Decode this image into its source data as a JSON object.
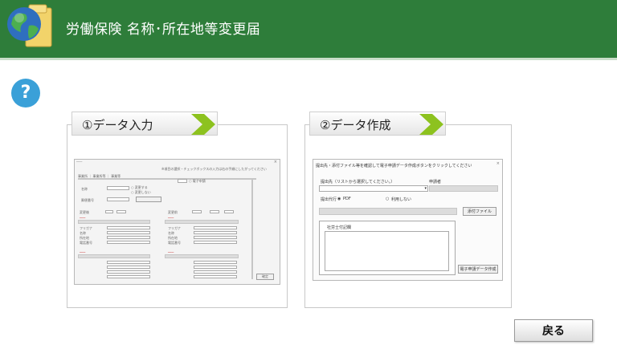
{
  "header": {
    "title": "労働保険 名称･所在地等変更届"
  },
  "help": {
    "label": "?"
  },
  "steps": [
    {
      "label": "①データ入力",
      "screen": {
        "note": "※項目の選択・チェックボックスの入力は右の手順にしたがってください",
        "tabs": "事業所 ｜ 事業所等 ｜ 事業等",
        "option_a": "○ 変更する",
        "option_b": "○ 変更しない",
        "side_note": "○ 電子申請",
        "section_left": "変更後",
        "section_right": "変更前",
        "field_name": "名称",
        "field_address": "所在地",
        "field_phone": "電話番号",
        "field_zip": "郵便番号",
        "field_kana": "フリガナ",
        "ok": "確定"
      }
    },
    {
      "label": "②データ作成",
      "screen": {
        "instruction": "提出先・添付ファイル等を確認して電子申請データ作成ボタンをクリックしてください",
        "dest_label": "提出先（リストから選択してください。）",
        "applicant_label": "申請者",
        "attach_label": "提出代行",
        "radio_pdf": "PDF",
        "radio_none": "利用しない",
        "attach_button": "添付ファイル",
        "memo_label": "社労士付記欄",
        "create_button": "電子申請データ作成"
      }
    }
  ],
  "back_button": {
    "label": "戻る"
  }
}
